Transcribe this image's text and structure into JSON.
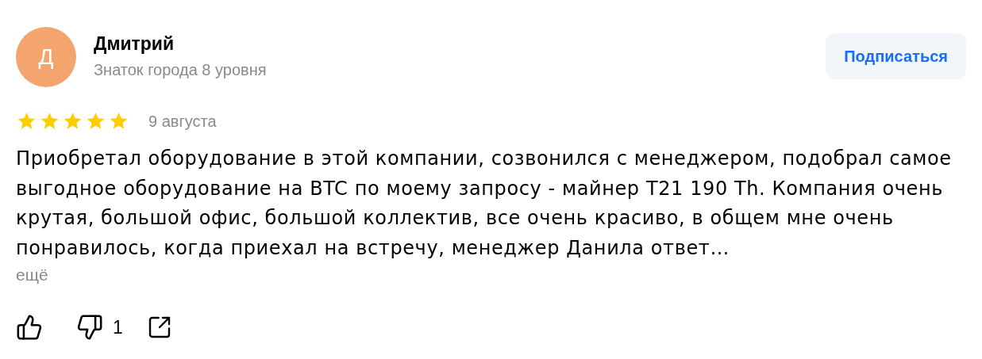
{
  "author": {
    "initial": "Д",
    "name": "Дмитрий",
    "level": "Знаток города 8 уровня",
    "color": "#f4a56e"
  },
  "subscribe_button": "Подписаться",
  "review": {
    "stars": 5,
    "date": "9 августа",
    "text": "Приобретал оборудование в этой компании, созвонился с менеджером, подобрал самое выгодное оборудование на BTC по моему запросу - майнер T21 190 Th. Компания очень крутая, большой офис, большой коллектив, все очень красиво, в общем мне очень понравилось, когда приехал на встречу, менеджер Данила ответ…",
    "more": "ещё"
  },
  "actions": {
    "dislike_count": "1"
  }
}
